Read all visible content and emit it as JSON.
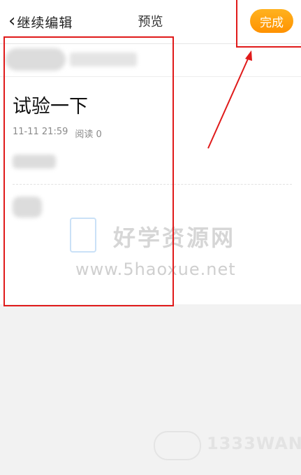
{
  "header": {
    "back_icon": "chevron-left-icon",
    "back_label": "继续编辑",
    "title": "预览",
    "done_label": "完成"
  },
  "article": {
    "title": "试验一下",
    "timestamp": "11-11 21:59",
    "reads": "阅读 0"
  },
  "watermark": {
    "logo_icon": "book-icon",
    "name": "好学资源网",
    "url": "www.5haoxue.net"
  },
  "footer_watermark": {
    "text": "1333WAN"
  },
  "colors": {
    "accent": "#ff9d0f",
    "annotation": "#e01a1a",
    "background": "#f2f2f2"
  }
}
